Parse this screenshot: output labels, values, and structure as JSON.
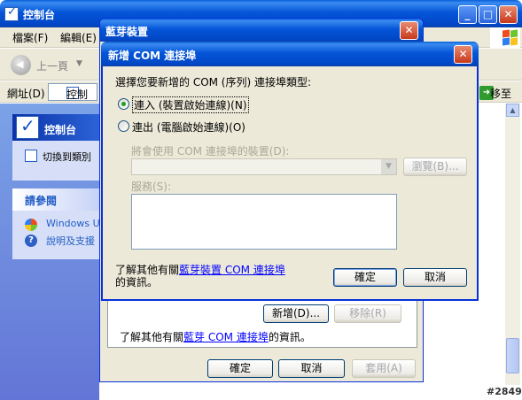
{
  "background_window": {
    "title": "控制台",
    "menu": [
      "檔案(F)",
      "編輯(E)"
    ],
    "toolbar_back": "上一頁",
    "address_label": "網址(D)",
    "address_value": "控制台",
    "go_label": "移至",
    "task_pane": {
      "header": "控制台",
      "switch_view": "切換到類別",
      "see_also_header": "請參閱",
      "see_also_items": [
        "Windows Up",
        "說明及支援"
      ]
    }
  },
  "bluetooth_dialog": {
    "title": "藍芽裝置",
    "add_button": "新增(D)...",
    "remove_button": "移除(R)",
    "footer_prefix": "了解其他有關",
    "footer_link": "藍芽 COM 連接埠",
    "footer_suffix": "的資訊。",
    "ok_button": "確定",
    "cancel_button": "取消",
    "apply_button": "套用(A)"
  },
  "com_dialog": {
    "title": "新增 COM 連接埠",
    "prompt": "選擇您要新增的 COM (序列) 連接埠類型:",
    "option_incoming": "連入 (裝置啟始連線)(N)",
    "option_outgoing": "連出 (電腦啟始連線)(O)",
    "selected_option": "incoming",
    "device_label": "將會使用 COM 連接埠的裝置(D):",
    "device_value": "",
    "browse_button": "瀏覽(B)...",
    "service_label": "服務(S):",
    "footer_prefix": "了解其他有關",
    "footer_link": "藍芽裝置 COM 連接埠",
    "footer_suffix": "的資訊。",
    "ok_button": "確定",
    "cancel_button": "取消"
  },
  "watermark": "#2849",
  "colors": {
    "title_bar": "#0047c6",
    "task_pane": "#6f8fe0",
    "link": "#0000ff",
    "dialog_face": "#ece9d8"
  }
}
